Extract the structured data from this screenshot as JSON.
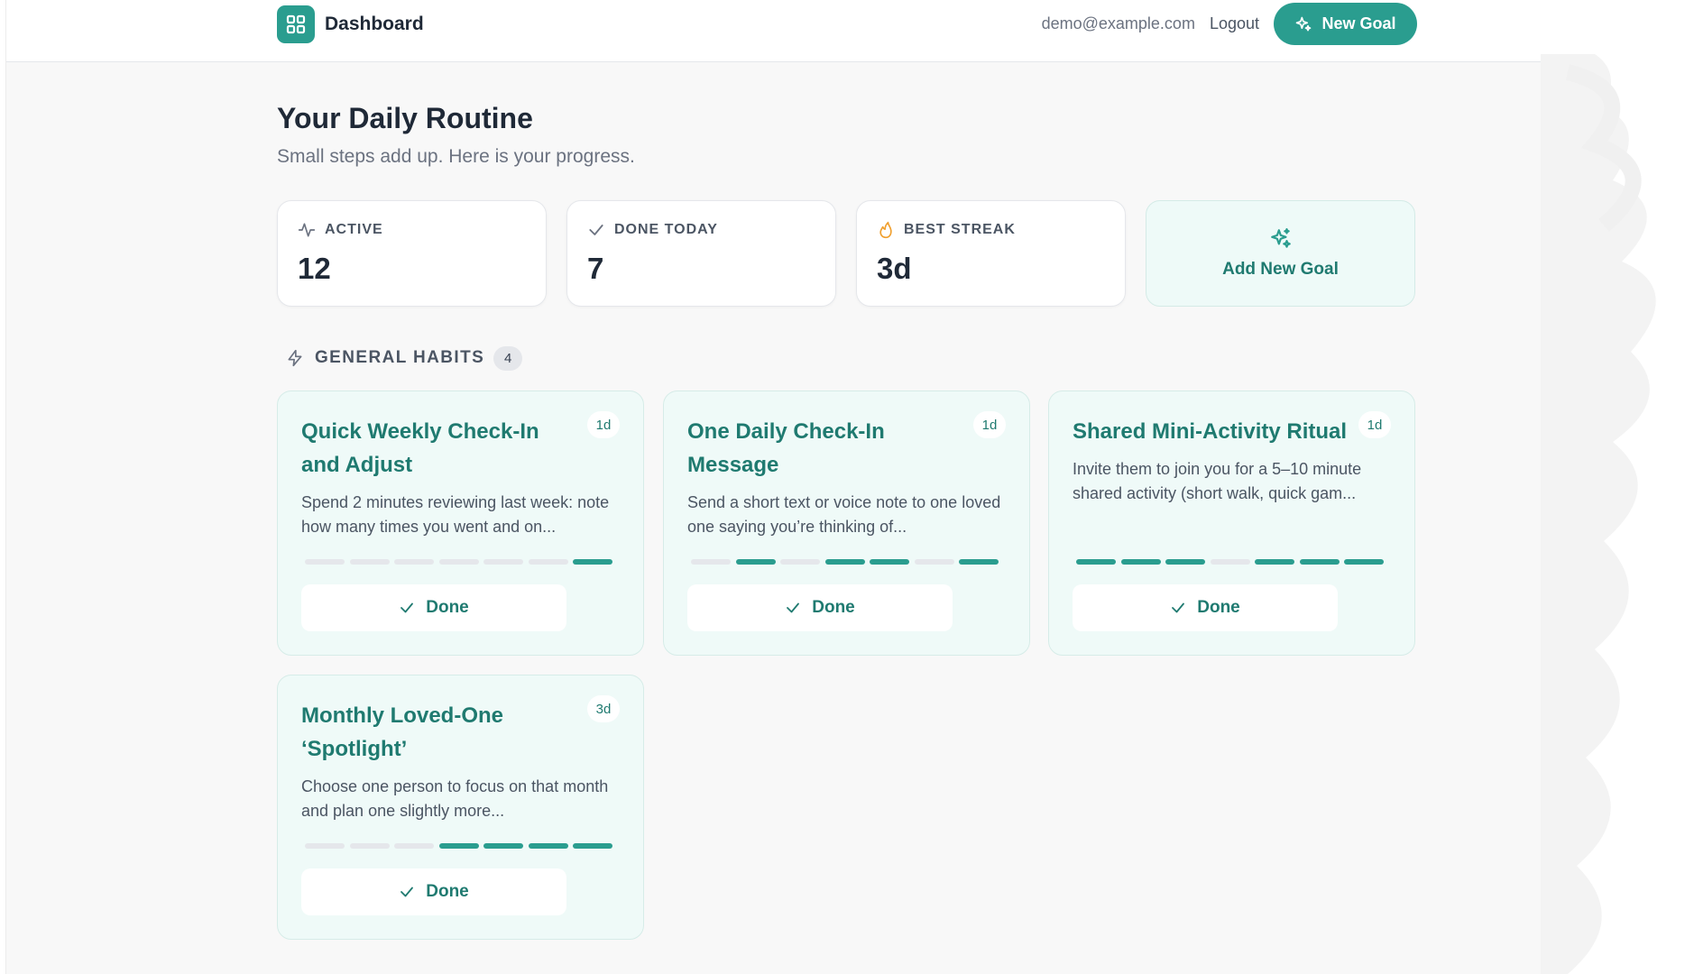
{
  "header": {
    "title": "Dashboard",
    "user_email": "demo@example.com",
    "logout_label": "Logout",
    "new_goal_label": "New Goal"
  },
  "page": {
    "title": "Your Daily Routine",
    "subtitle": "Small steps add up. Here is your progress."
  },
  "stats": [
    {
      "icon": "activity-icon",
      "label": "ACTIVE",
      "value": "12"
    },
    {
      "icon": "check-icon",
      "label": "DONE TODAY",
      "value": "7"
    },
    {
      "icon": "flame-icon",
      "label": "BEST STREAK",
      "value": "3d"
    }
  ],
  "add_goal": {
    "icon": "sparkles-icon",
    "label": "Add New Goal"
  },
  "section": {
    "icon": "lightning-icon",
    "title": "GENERAL HABITS",
    "count": "4"
  },
  "habits": [
    {
      "title": "Quick Weekly Check-In and Adjust",
      "badge": "1d",
      "description": "Spend 2 minutes reviewing last week: note how many times you went and on...",
      "progress": [
        false,
        false,
        false,
        false,
        false,
        false,
        true
      ],
      "done_label": "Done"
    },
    {
      "title": "One Daily Check-In Message",
      "badge": "1d",
      "description": "Send a short text or voice note to one loved one saying you’re thinking of...",
      "progress": [
        false,
        true,
        false,
        true,
        true,
        false,
        true
      ],
      "done_label": "Done"
    },
    {
      "title": "Shared Mini-Activity Ritual",
      "badge": "1d",
      "description": "Invite them to join you for a 5–10 minute shared activity (short walk, quick gam...",
      "progress": [
        true,
        true,
        true,
        false,
        true,
        true,
        true
      ],
      "done_label": "Done"
    },
    {
      "title": "Monthly Loved-One ‘Spotlight’",
      "badge": "3d",
      "description": "Choose one person to focus on that month and plan one slightly more...",
      "progress": [
        false,
        false,
        false,
        true,
        true,
        true,
        true
      ],
      "done_label": "Done"
    }
  ],
  "colors": {
    "accent": "#2a9d8f",
    "accent_text": "#1f7a70",
    "card_tint": "#effaf8",
    "flame": "#f0a030"
  }
}
